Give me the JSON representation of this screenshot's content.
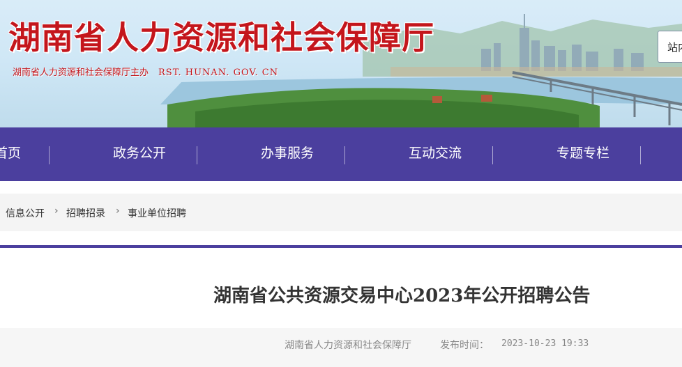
{
  "header": {
    "site_title": "湖南省人力资源和社会保障厅",
    "sponsor": "湖南省人力资源和社会保障厅主办",
    "domain": "RST. HUNAN. GOV. CN",
    "top_link": "站内"
  },
  "nav": {
    "items": [
      {
        "label": "首页"
      },
      {
        "label": "政务公开"
      },
      {
        "label": "办事服务"
      },
      {
        "label": "互动交流"
      },
      {
        "label": "专题专栏"
      }
    ]
  },
  "breadcrumb": [
    {
      "label": "信息公开"
    },
    {
      "label": "招聘招录"
    },
    {
      "label": "事业单位招聘"
    }
  ],
  "article": {
    "title": "湖南省公共资源交易中心2023年公开招聘公告",
    "source": "湖南省人力资源和社会保障厅",
    "publish_label": "发布时间：",
    "publish_time": "2023-10-23 19:33"
  },
  "colors": {
    "brand_red": "#c4161c",
    "nav_purple": "#4b3f9e"
  }
}
